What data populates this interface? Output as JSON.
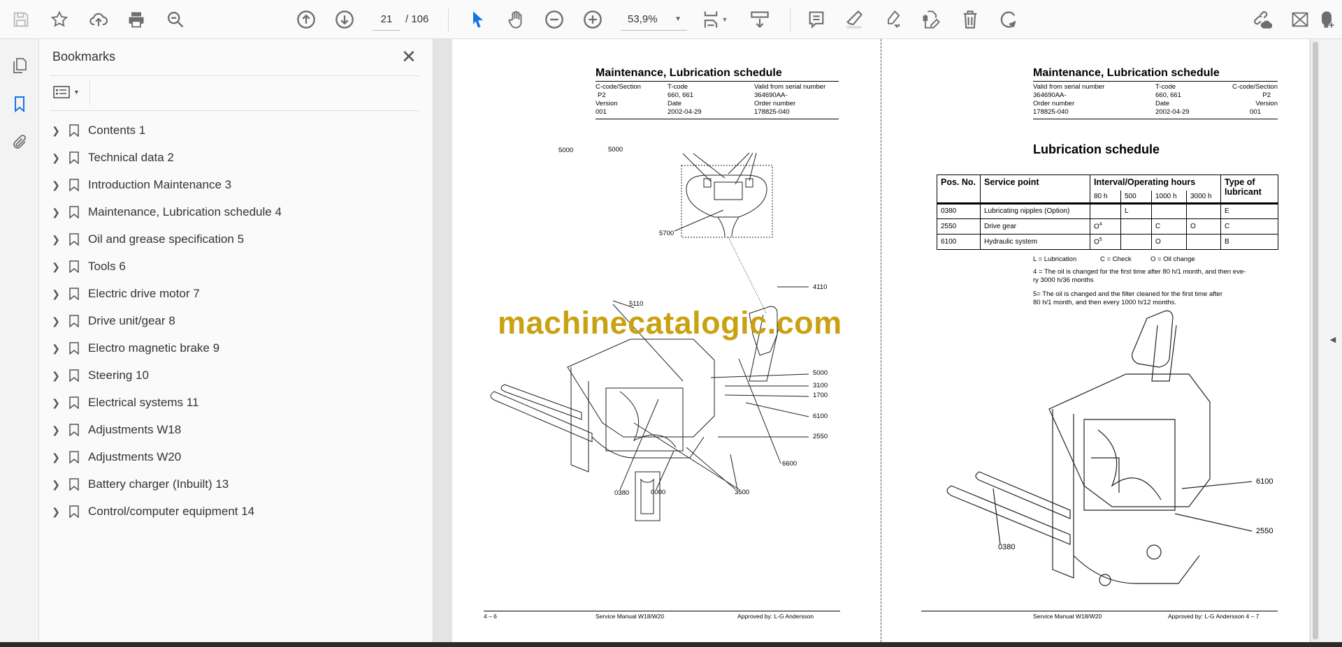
{
  "toolbar": {
    "page_current": "21",
    "page_total": "/ 106",
    "zoom": "53,9%",
    "icons": [
      "save-icon",
      "star-icon",
      "upload-icon",
      "print-icon",
      "search-zoom-icon",
      "page-up-icon",
      "page-down-icon",
      "select-cursor-icon",
      "hand-icon",
      "zoom-out-icon",
      "zoom-in-icon",
      "fit-page-icon",
      "scroll-mode-icon",
      "comment-icon",
      "highlight-icon",
      "sign-icon",
      "edit-pdf-icon",
      "delete-icon",
      "rotate-icon",
      "share-link-icon",
      "email-icon",
      "add-user-icon"
    ]
  },
  "sidebar": {
    "title": "Bookmarks",
    "items": [
      {
        "label": "Contents 1"
      },
      {
        "label": "Technical data 2"
      },
      {
        "label": "Introduction Maintenance 3"
      },
      {
        "label": "Maintenance, Lubrication schedule 4"
      },
      {
        "label": "Oil and grease specification 5"
      },
      {
        "label": "Tools 6"
      },
      {
        "label": "Electric drive motor 7"
      },
      {
        "label": "Drive unit/gear 8"
      },
      {
        "label": "Electro magnetic brake 9"
      },
      {
        "label": "Steering 10"
      },
      {
        "label": "Electrical systems 11"
      },
      {
        "label": "Adjustments W18"
      },
      {
        "label": "Adjustments W20"
      },
      {
        "label": "Battery charger (Inbuilt) 13"
      },
      {
        "label": "Control/computer equipment 14"
      }
    ]
  },
  "left_page": {
    "title": "Maintenance, Lubrication schedule",
    "header": {
      "ccode_label": "C-code/Section",
      "ccode": "P2",
      "tcode_label": "T-code",
      "tcode": "660, 661",
      "valid_label": "Valid from serial number",
      "valid": "364690AA-",
      "version_label": "Version",
      "version": "001",
      "date_label": "Date",
      "date": "2002-04-29",
      "order_label": "Order number",
      "order": "178825-040"
    },
    "callouts": {
      "a": "5000",
      "b": "5000",
      "c": "5700",
      "d": "4110",
      "e": "5110",
      "f": "5000",
      "g": "3100",
      "h": "1700",
      "i": "6100",
      "j": "2550",
      "k": "6600",
      "l": "0380",
      "m": "0000",
      "n": "3500"
    },
    "footer": {
      "page": "4 – 6",
      "manual": "Service Manual W18/W20",
      "approved": "Approved by: L-G Andersson"
    }
  },
  "right_page": {
    "title": "Maintenance, Lubrication schedule",
    "header": {
      "valid_label": "Valid from serial number",
      "valid": "364690AA-",
      "tcode_label": "T-code",
      "tcode": "660, 661",
      "ccode_label": "C-code/Section",
      "ccode": "P2",
      "order_label": "Order number",
      "order": "178825-040",
      "date_label": "Date",
      "date": "2002-04-29",
      "version_label": "Version",
      "version": "001"
    },
    "section_title": "Lubrication schedule",
    "table": {
      "h_pos": "Pos. No.",
      "h_service": "Service point",
      "h_interval": "Interval/Operating hours",
      "h_type": "Type of lubricant",
      "sub": [
        "80 h",
        "500",
        "1000 h",
        "3000 h"
      ],
      "rows": [
        {
          "pos": "0380",
          "point": "Lubricating nipples (Option)",
          "h80": "",
          "h500": "L",
          "h1000": "",
          "h3000": "",
          "type": "E"
        },
        {
          "pos": "2550",
          "point": "Drive gear",
          "h80": "O",
          "h80_sup": "4",
          "h500": "",
          "h1000": "C",
          "h3000": "O",
          "type": "C"
        },
        {
          "pos": "6100",
          "point": "Hydraulic system",
          "h80": "O",
          "h80_sup": "5",
          "h500": "",
          "h1000": "O",
          "h3000": "",
          "type": "B"
        }
      ]
    },
    "legend": {
      "l": "L = Lubrication",
      "c": "C = Check",
      "o": "O = Oil change"
    },
    "note4a": "4 = The oil is changed for the first time after 80 h/1 month, and then eve-",
    "note4b": "ry 3000 h/36 months",
    "note5a": "5= The oil is changed and the filter cleaned for the first time after",
    "note5b": "80 h/1 month, and then every 1000 h/12 months.",
    "callouts": {
      "a": "6100",
      "b": "2550",
      "c": "0380"
    },
    "footer": {
      "manual": "Service Manual W18/W20",
      "approved": "Approved by: L-G Andersson 4 – 7"
    }
  },
  "watermark": "machinecatalogic.com",
  "colors": {
    "accent": "#1473e6",
    "watermark": "#c9a212"
  }
}
